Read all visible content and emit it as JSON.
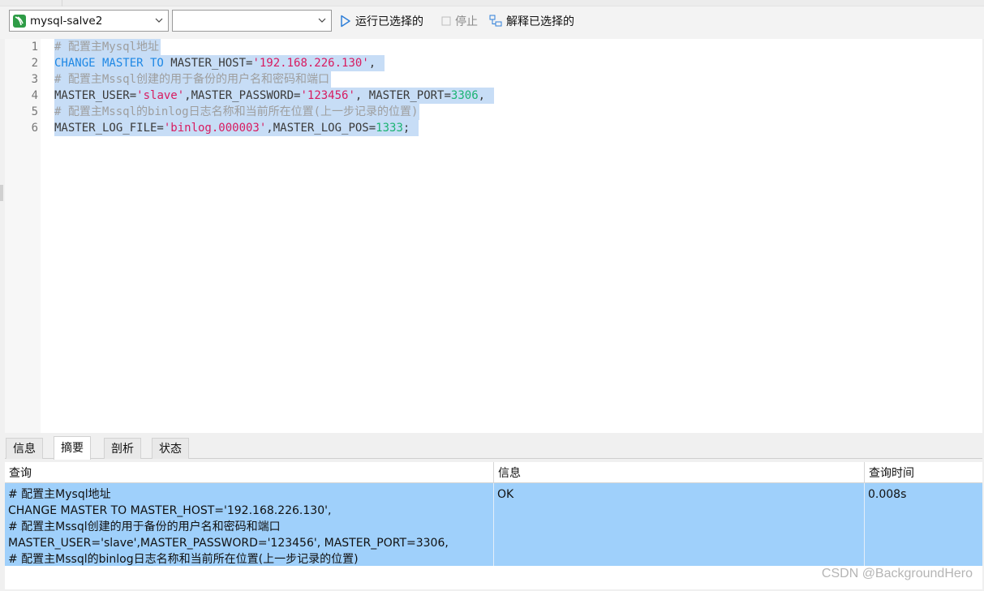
{
  "toolbar": {
    "connection_value": "mysql-salve2",
    "database_value": "",
    "run_label": "运行已选择的",
    "stop_label": "停止",
    "explain_label": "解释已选择的"
  },
  "editor": {
    "line_numbers": [
      "1",
      "2",
      "3",
      "4",
      "5",
      "6"
    ],
    "lines": [
      [
        {
          "c": "cm",
          "t": "# 配置主Mysql地址"
        }
      ],
      [
        {
          "c": "kw",
          "t": "CHANGE MASTER TO "
        },
        {
          "c": "tx",
          "t": "MASTER_HOST="
        },
        {
          "c": "st",
          "t": "'192.168.226.130'"
        },
        {
          "c": "tx",
          "t": ", "
        }
      ],
      [
        {
          "c": "cm",
          "t": "# 配置主Mssql创建的用于备份的用户名和密码和端口"
        }
      ],
      [
        {
          "c": "tx",
          "t": "MASTER_USER="
        },
        {
          "c": "st",
          "t": "'slave'"
        },
        {
          "c": "tx",
          "t": ",MASTER_PASSWORD="
        },
        {
          "c": "st",
          "t": "'123456'"
        },
        {
          "c": "tx",
          "t": ", MASTER_PORT="
        },
        {
          "c": "nm",
          "t": "3306"
        },
        {
          "c": "tx",
          "t": ", "
        }
      ],
      [
        {
          "c": "cm",
          "t": "# 配置主Mssql的binlog日志名称和当前所在位置(上一步记录的位置)"
        }
      ],
      [
        {
          "c": "tx",
          "t": "MASTER_LOG_FILE="
        },
        {
          "c": "st",
          "t": "'binlog.000003'"
        },
        {
          "c": "tx",
          "t": ",MASTER_LOG_POS="
        },
        {
          "c": "nm",
          "t": "1333"
        },
        {
          "c": "tx",
          "t": "; "
        }
      ]
    ]
  },
  "result_tabs": [
    "信息",
    "摘要",
    "剖析",
    "状态"
  ],
  "active_tab": "摘要",
  "grid": {
    "headers": [
      "查询",
      "信息",
      "查询时间"
    ],
    "row": {
      "query_lines": [
        "# 配置主Mysql地址",
        "CHANGE MASTER TO MASTER_HOST='192.168.226.130',",
        "# 配置主Mssql创建的用于备份的用户名和密码和端口",
        "MASTER_USER='slave',MASTER_PASSWORD='123456', MASTER_PORT=3306,",
        "# 配置主Mssql的binlog日志名称和当前所在位置(上一步记录的位置)"
      ],
      "info": "OK",
      "time": "0.008s"
    }
  },
  "watermark": "CSDN @BackgroundHero",
  "colors": {
    "selection": "#c7ddf6",
    "keyword": "#1e88e5",
    "string": "#d81b60",
    "number": "#1bb373",
    "comment": "#9e9e9e",
    "row_highlight": "#9fd0fb"
  }
}
